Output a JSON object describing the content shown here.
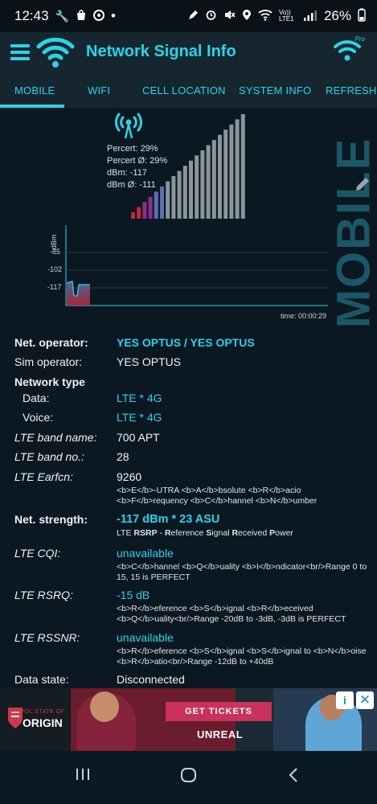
{
  "status_bar": {
    "time": "12:43",
    "network_tag": "Vo)) LTE1",
    "battery": "26%",
    "icons": [
      "wrench-icon",
      "bag-icon",
      "whatsapp-icon",
      "dot-icon",
      "pen-icon",
      "alarm-icon",
      "mute-icon",
      "location-icon",
      "wifi-icon",
      "signal-icon",
      "battery-icon"
    ]
  },
  "app_bar": {
    "title": "Network Signal Info",
    "pro_label": "Pro"
  },
  "tabs": [
    {
      "label": "MOBILE",
      "selected": true
    },
    {
      "label": "WIFI"
    },
    {
      "label": "CELL LOCATION"
    },
    {
      "label": "SYSTEM INFO"
    },
    {
      "label": "REFRESH S"
    }
  ],
  "signal": {
    "side_label": "MOBILE",
    "percent": "Percert: 29%",
    "percent_avg": "Percert Ø: 29%",
    "dbm": "dBm: -117",
    "dbm_avg": "dBm Ø: -111",
    "level": 0.29,
    "colors": {
      "active_low": "#c0283a",
      "active_mid": "#8a2e8c",
      "active_high": "#5a6fb0",
      "inactive": "#8a959c"
    }
  },
  "graph": {
    "ylabel": "dBm",
    "ticks": [
      "-85",
      "-102",
      "-117"
    ],
    "time": "time: 00:00:29"
  },
  "info": {
    "net_operator_label": "Net. operator:",
    "net_operator_value": "YES OPTUS / YES OPTUS",
    "sim_operator_label": "Sim operator:",
    "sim_operator_value": "YES OPTUS",
    "network_type_label": "Network type",
    "data_label": "Data:",
    "data_value": "LTE * 4G",
    "voice_label": "Voice:",
    "voice_value": "LTE * 4G",
    "band_name_label": "LTE band name:",
    "band_name_value": "700 APT",
    "band_no_label": "LTE band no.:",
    "band_no_value": "28",
    "earfcn_label": "LTE Earfcn:",
    "earfcn_value": "9260",
    "earfcn_desc": "<b>E</b>-UTRA <b>A</b>bsolute <b>R</b>acio <b>F</b>requency <b>C</b>hannel <b>N</b>umber",
    "strength_label": "Net. strength:",
    "strength_value": "-117 dBm * 23 ASU",
    "strength_desc_1": "LTE ",
    "strength_desc_2": "RSRP",
    "strength_desc_3": " - ",
    "strength_desc_4": "R",
    "strength_desc_5": "eference ",
    "strength_desc_6": "S",
    "strength_desc_7": "ignal ",
    "strength_desc_8": "R",
    "strength_desc_9": "eceived ",
    "strength_desc_10": "P",
    "strength_desc_11": "ower",
    "cqi_label": "LTE CQI:",
    "cqi_value": "unavailable",
    "cqi_desc": "<b>C</b>hannel <b>Q</b>uality <b>I</b>ndicator<br/>Range 0 to 15, 15 is PERFECT",
    "rsrq_label": "LTE RSRQ:",
    "rsrq_value": "-15 dB",
    "rsrq_desc": "<b>R</b>eference <b>S</b>ignal <b>R</b>eceived <b>Q</b>uality<br/>Range -20dB to -3dB, -3dB is PERFECT",
    "rssnr_label": "LTE RSSNR:",
    "rssnr_value": "unavailable",
    "rssnr_desc": "<b>R</b>eference <b>S</b>ignal <b>S</b>ignal to <b>N</b>oise <b>R</b>atio<br/>Range -12dB to +40dB",
    "data_state_label": "Data state:",
    "data_state_value": "Disconnected"
  },
  "ad": {
    "logo_sub": "AMPOL STATE OF",
    "logo": "ORIGIN",
    "cta": "GET TICKETS",
    "brand": "UNREAL",
    "info_icon": "i",
    "close_icon": "✕"
  }
}
